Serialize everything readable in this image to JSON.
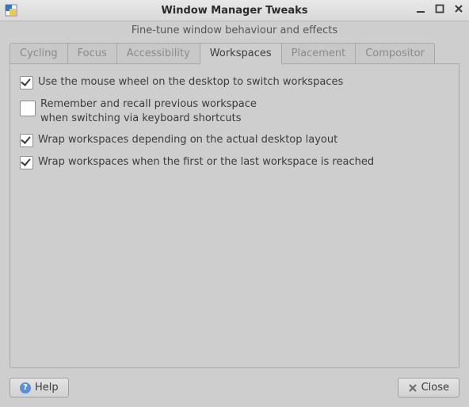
{
  "window": {
    "title": "Window Manager Tweaks",
    "subtitle": "Fine-tune window behaviour and effects"
  },
  "tabs": [
    {
      "label": "Cycling",
      "active": false
    },
    {
      "label": "Focus",
      "active": false
    },
    {
      "label": "Accessibility",
      "active": false
    },
    {
      "label": "Workspaces",
      "active": true
    },
    {
      "label": "Placement",
      "active": false
    },
    {
      "label": "Compositor",
      "active": false
    }
  ],
  "workspaces": {
    "options": [
      {
        "label": "Use the mouse wheel on the desktop to switch workspaces",
        "checked": true
      },
      {
        "label": "Remember and recall previous workspace\nwhen switching via keyboard shortcuts",
        "checked": false
      },
      {
        "label": "Wrap workspaces depending on the actual desktop layout",
        "checked": true
      },
      {
        "label": "Wrap workspaces when the first or the last workspace is reached",
        "checked": true
      }
    ]
  },
  "buttons": {
    "help": "Help",
    "close": "Close"
  }
}
